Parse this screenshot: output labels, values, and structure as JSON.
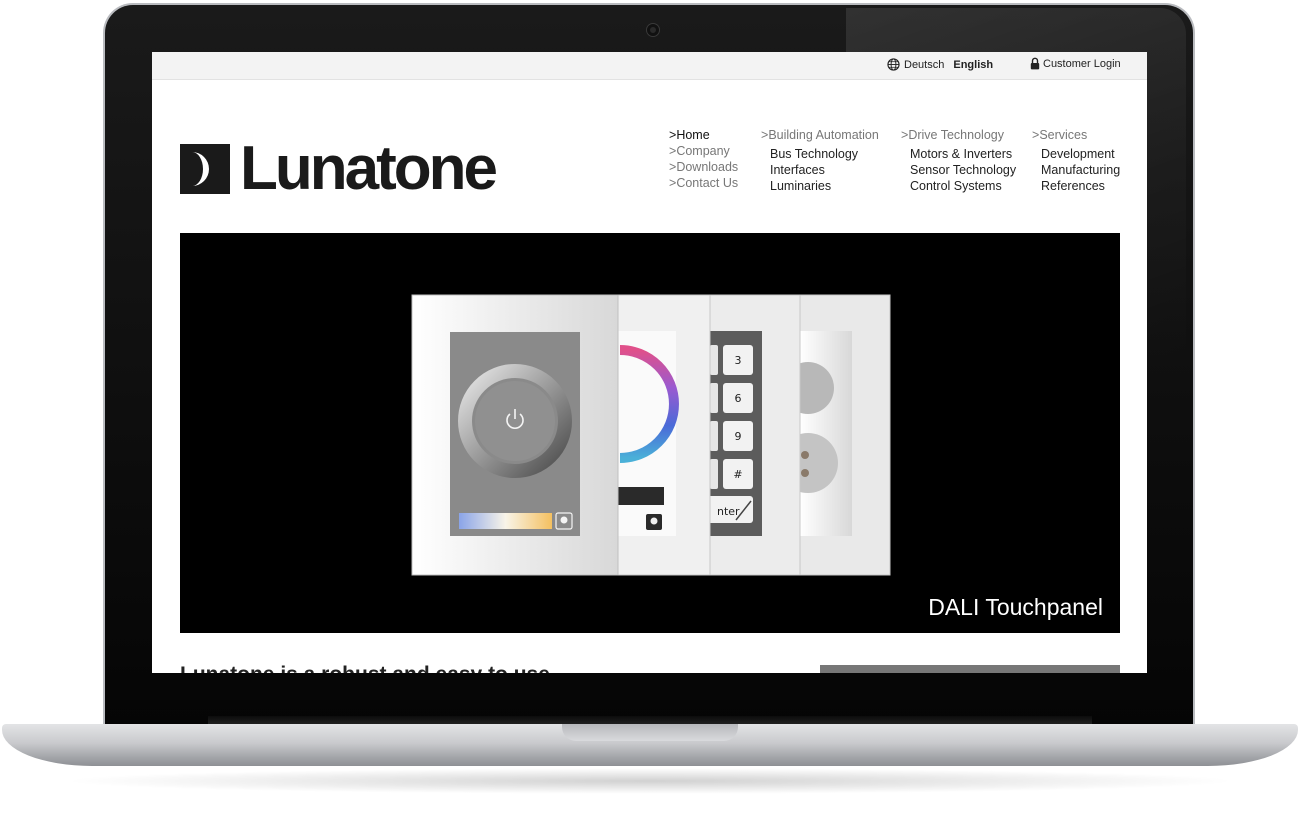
{
  "topbar": {
    "lang_de": "Deutsch",
    "lang_en": "English",
    "login_label": "Customer Login"
  },
  "brand": {
    "logo_text": "Lunatone"
  },
  "nav": {
    "main": [
      {
        "label": "Home",
        "active": true
      },
      {
        "label": "Company"
      },
      {
        "label": "Downloads"
      },
      {
        "label": "Contact Us"
      }
    ],
    "building": {
      "label": "Building Automation",
      "items": [
        "Bus Technology",
        "Interfaces",
        "Luminaries"
      ]
    },
    "drive": {
      "label": "Drive Technology",
      "items": [
        "Motors & Inverters",
        "Sensor Technology",
        "Control Systems"
      ]
    },
    "services": {
      "label": "Services",
      "items": [
        "Development",
        "Manufacturing",
        "References"
      ]
    },
    "chevron": ">"
  },
  "hero": {
    "caption": "DALI Touchpanel",
    "keypad": [
      "3",
      "6",
      "9",
      "#"
    ],
    "enter_label": "nter"
  },
  "below": {
    "headline_partial": "Lunatone is a robust and easy to use ..."
  },
  "colors": {
    "hero_bg": "#000000",
    "topbar_bg": "#f3f3f3",
    "text_dark": "#222222",
    "text_muted": "#777777"
  }
}
